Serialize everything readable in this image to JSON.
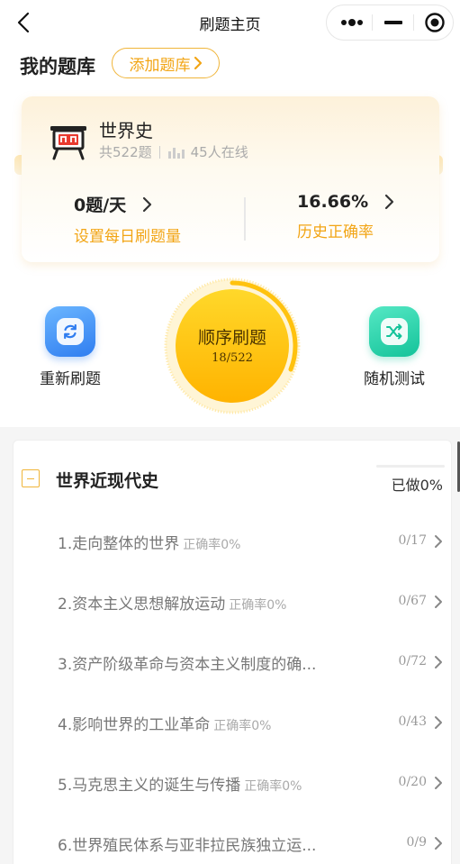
{
  "nav": {
    "title": "刷题主页"
  },
  "library": {
    "title": "我的题库",
    "add_label": "添加题库"
  },
  "book": {
    "name": "世界史",
    "total": "共522题",
    "online": "45人在线",
    "daily": {
      "value": "0题/天",
      "label": "设置每日刷题量"
    },
    "accuracy": {
      "value": "16.66%",
      "label": "历史正确率"
    }
  },
  "actions": {
    "refresh_label": "重新刷题",
    "sequential_label": "顺序刷题",
    "sequential_count": "18/522",
    "sequential_progress": 0.0345,
    "random_label": "随机测试"
  },
  "section": {
    "title": "世界近现代史",
    "progress_text": "已做0%",
    "progress": 0
  },
  "chapters": [
    {
      "title": "1.走向整体的世界",
      "accuracy": "正确率0%",
      "count": "0/17"
    },
    {
      "title": "2.资本主义思想解放运动",
      "accuracy": "正确率0%",
      "count": "0/67"
    },
    {
      "title": "3.资产阶级革命与资本主义制度的确...",
      "accuracy": "",
      "count": "0/72"
    },
    {
      "title": "4.影响世界的工业革命",
      "accuracy": "正确率0%",
      "count": "0/43"
    },
    {
      "title": "5.马克思主义的诞生与传播",
      "accuracy": "正确率0%",
      "count": "0/20"
    },
    {
      "title": "6.世界殖民体系与亚非拉民族独立运...",
      "accuracy": "",
      "count": "0/9"
    }
  ],
  "colors": {
    "accent": "#f2a515",
    "accent_border": "#f0b53a",
    "refresh_blue": "#2f7df0",
    "random_green": "#14c39a",
    "big_button": "#ffc20e"
  },
  "icons": {
    "back": "chevron-left-icon",
    "more": "more-dots-icon",
    "minimize": "minimize-icon",
    "close": "target-close-icon",
    "book": "book-cart-icon",
    "bars": "signal-bars-icon",
    "refresh": "refresh-icon",
    "random": "shuffle-icon",
    "collapse": "collapse-box-icon"
  }
}
